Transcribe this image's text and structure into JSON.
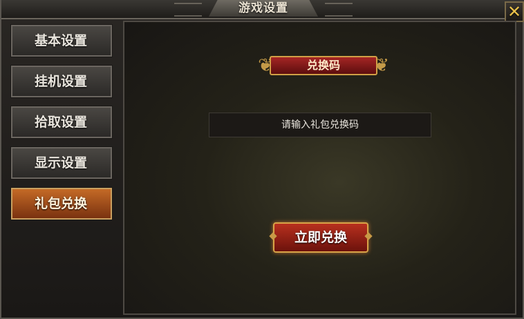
{
  "window": {
    "title": "游戏设置",
    "close_label": "✕"
  },
  "sidebar": {
    "items": [
      {
        "label": "基本设置",
        "active": false
      },
      {
        "label": "挂机设置",
        "active": false
      },
      {
        "label": "拾取设置",
        "active": false
      },
      {
        "label": "显示设置",
        "active": false
      },
      {
        "label": "礼包兑换",
        "active": true
      }
    ]
  },
  "redeem": {
    "banner_label": "兑换码",
    "input_placeholder": "请输入礼包兑换码",
    "input_value": "",
    "button_label": "立即兑换"
  },
  "colors": {
    "accent_gold": "#d0a046",
    "active_tab": "#c46a26",
    "button_red": "#b8301e"
  }
}
